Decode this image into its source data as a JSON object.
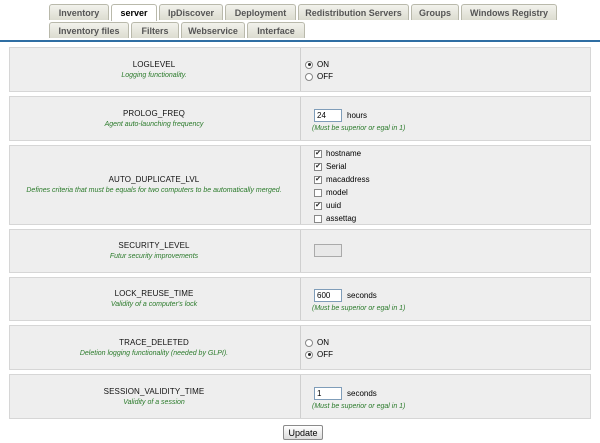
{
  "tabs_row1": [
    {
      "label": "Inventory",
      "active": false
    },
    {
      "label": "server",
      "active": true
    },
    {
      "label": "IpDiscover",
      "active": false
    },
    {
      "label": "Deployment",
      "active": false
    },
    {
      "label": "Redistribution Servers",
      "active": false
    },
    {
      "label": "Groups",
      "active": false
    },
    {
      "label": "Windows Registry",
      "active": false
    }
  ],
  "tabs_row2": [
    {
      "label": "Inventory files"
    },
    {
      "label": "Filters"
    },
    {
      "label": "Webservice"
    },
    {
      "label": "Interface"
    }
  ],
  "options": {
    "loglevel": {
      "name": "LOGLEVEL",
      "desc": "Logging functionality.",
      "radio": [
        {
          "label": "ON",
          "checked": true
        },
        {
          "label": "OFF",
          "checked": false
        }
      ]
    },
    "prolog_freq": {
      "name": "PROLOG_FREQ",
      "desc": "Agent auto-launching frequency",
      "value": "24",
      "unit": "hours",
      "hint": "(Must be superior or egal in 1)"
    },
    "auto_duplicate": {
      "name": "AUTO_DUPLICATE_LVL",
      "desc": "Defines criteria that must be equals for two computers to be automatically merged.",
      "checks": [
        {
          "label": "hostname",
          "checked": true
        },
        {
          "label": "Serial",
          "checked": true
        },
        {
          "label": "macaddress",
          "checked": true
        },
        {
          "label": "model",
          "checked": false
        },
        {
          "label": "uuid",
          "checked": true
        },
        {
          "label": "assettag",
          "checked": false
        }
      ]
    },
    "security_level": {
      "name": "SECURITY_LEVEL",
      "desc": "Futur security improvements",
      "value": ""
    },
    "lock_reuse": {
      "name": "LOCK_REUSE_TIME",
      "desc": "Validity of a computer's lock",
      "value": "600",
      "unit": "seconds",
      "hint": "(Must be superior or egal in 1)"
    },
    "trace_deleted": {
      "name": "TRACE_DELETED",
      "desc": "Deletion logging functionality (needed by GLPI).",
      "radio": [
        {
          "label": "ON",
          "checked": false
        },
        {
          "label": "OFF",
          "checked": true
        }
      ]
    },
    "session_validity": {
      "name": "SESSION_VALIDITY_TIME",
      "desc": "Validity of a session",
      "value": "1",
      "unit": "seconds",
      "hint": "(Must be superior or egal in 1)"
    }
  },
  "update_label": "Update"
}
